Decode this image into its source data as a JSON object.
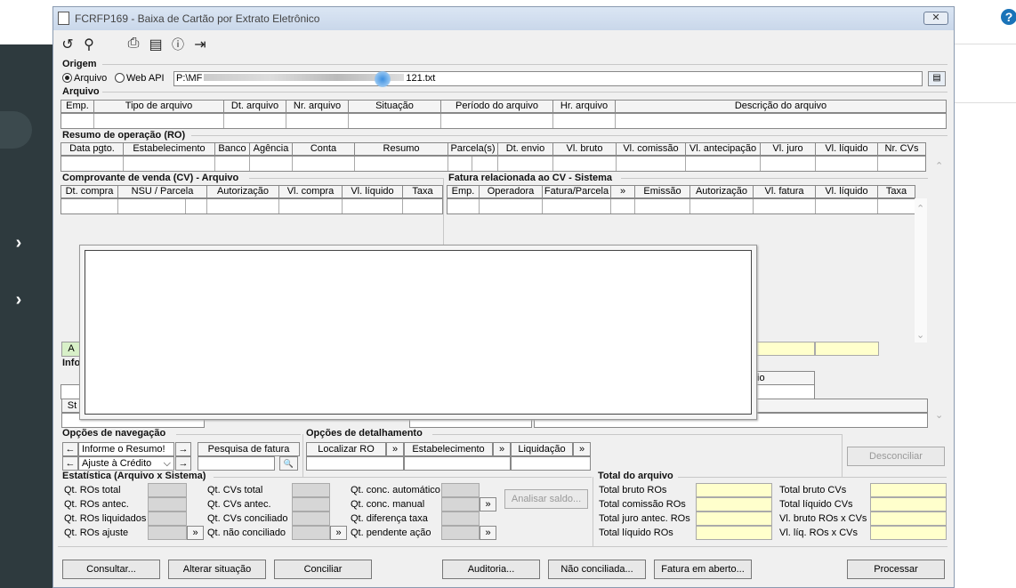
{
  "window": {
    "title": "FCRFP169 - Baixa de Cartão por Extrato Eletrônico",
    "close_label": "✕"
  },
  "icons": {
    "refresh": "refresh-icon",
    "search": "search-icon",
    "print": "print-icon",
    "calendar": "calendar-icon",
    "help": "help-icon",
    "exit": "exit-icon"
  },
  "origem": {
    "section": "Origem",
    "radio_arquivo": "Arquivo",
    "radio_webapi": "Web API",
    "selected": "Arquivo",
    "path_prefix": "P:\\MF",
    "path_suffix": "121.txt"
  },
  "arquivo": {
    "section": "Arquivo",
    "columns": [
      "Emp.",
      "Tipo de arquivo",
      "Dt. arquivo",
      "Nr. arquivo",
      "Situação",
      "Período do arquivo",
      "Hr. arquivo",
      "Descrição do arquivo"
    ]
  },
  "resumo": {
    "section": "Resumo de operação (RO)",
    "columns": [
      "Data pgto.",
      "Estabelecimento",
      "Banco",
      "Agência",
      "Conta",
      "Resumo",
      "Parcela(s)",
      "Dt. envio",
      "Vl. bruto",
      "Vl. comissão",
      "Vl. antecipação",
      "Vl. juro",
      "Vl. líquido",
      "Nr. CVs"
    ]
  },
  "comprovante": {
    "section": "Comprovante de venda (CV) - Arquivo",
    "columns": [
      "Dt. compra",
      "NSU / Parcela",
      "Autorização",
      "Vl. compra",
      "Vl. líquido",
      "Taxa"
    ]
  },
  "fatura": {
    "section": "Fatura relacionada ao CV - Sistema",
    "columns": [
      "Emp.",
      "Operadora",
      "Fatura/Parcela",
      "»",
      "Emissão",
      "Autorização",
      "Vl. fatura",
      "Vl. líquido",
      "Taxa"
    ]
  },
  "partial": {
    "a": "A",
    "info": "Info",
    "st": "St",
    "io": "io"
  },
  "navegacao": {
    "section": "Opções de navegação",
    "left_arrow": "←",
    "right_arrow": "→",
    "select1": "Informe o Resumo!",
    "select2": "Ajuste à Crédito",
    "search_label": "Pesquisa de fatura",
    "magnify": "🔍"
  },
  "detalhamento": {
    "section": "Opções de detalhamento",
    "localizar": "Localizar RO",
    "estabelecimento": "Estabelecimento",
    "liquidacao": "Liquidação",
    "chevron": "»"
  },
  "desconciliar": "Desconciliar",
  "estatistica": {
    "section": "Estatística (Arquivo x Sistema)",
    "col1": [
      "Qt. ROs total",
      "Qt. ROs antec.",
      "Qt. ROs liquidados",
      "Qt. ROs ajuste"
    ],
    "col2": [
      "Qt. CVs total",
      "Qt. CVs antec.",
      "Qt. CVs conciliado",
      "Qt. não conciliado"
    ],
    "col3": [
      "Qt. conc. automático",
      "Qt. conc. manual",
      "Qt. diferença taxa",
      "Qt. pendente ação"
    ],
    "analisar": "Analisar saldo...",
    "chevron": "»"
  },
  "total": {
    "section": "Total do arquivo",
    "col1": [
      "Total bruto ROs",
      "Total comissão ROs",
      "Total juro antec. ROs",
      "Total líquido ROs"
    ],
    "col2": [
      "Total bruto CVs",
      "Total líquido CVs",
      "Vl. bruto ROs x CVs",
      "Vl. líq. ROs x CVs"
    ]
  },
  "buttons": {
    "consultar": "Consultar...",
    "alterar": "Alterar situação",
    "conciliar": "Conciliar",
    "auditoria": "Auditoria...",
    "nao_conciliada": "Não conciliada...",
    "fatura_aberto": "Fatura em aberto...",
    "processar": "Processar"
  },
  "colors": {
    "sidebar": "#2e3a3e",
    "highlight_yellow": "#ffffcc",
    "accent_blue": "#1a73b8"
  }
}
